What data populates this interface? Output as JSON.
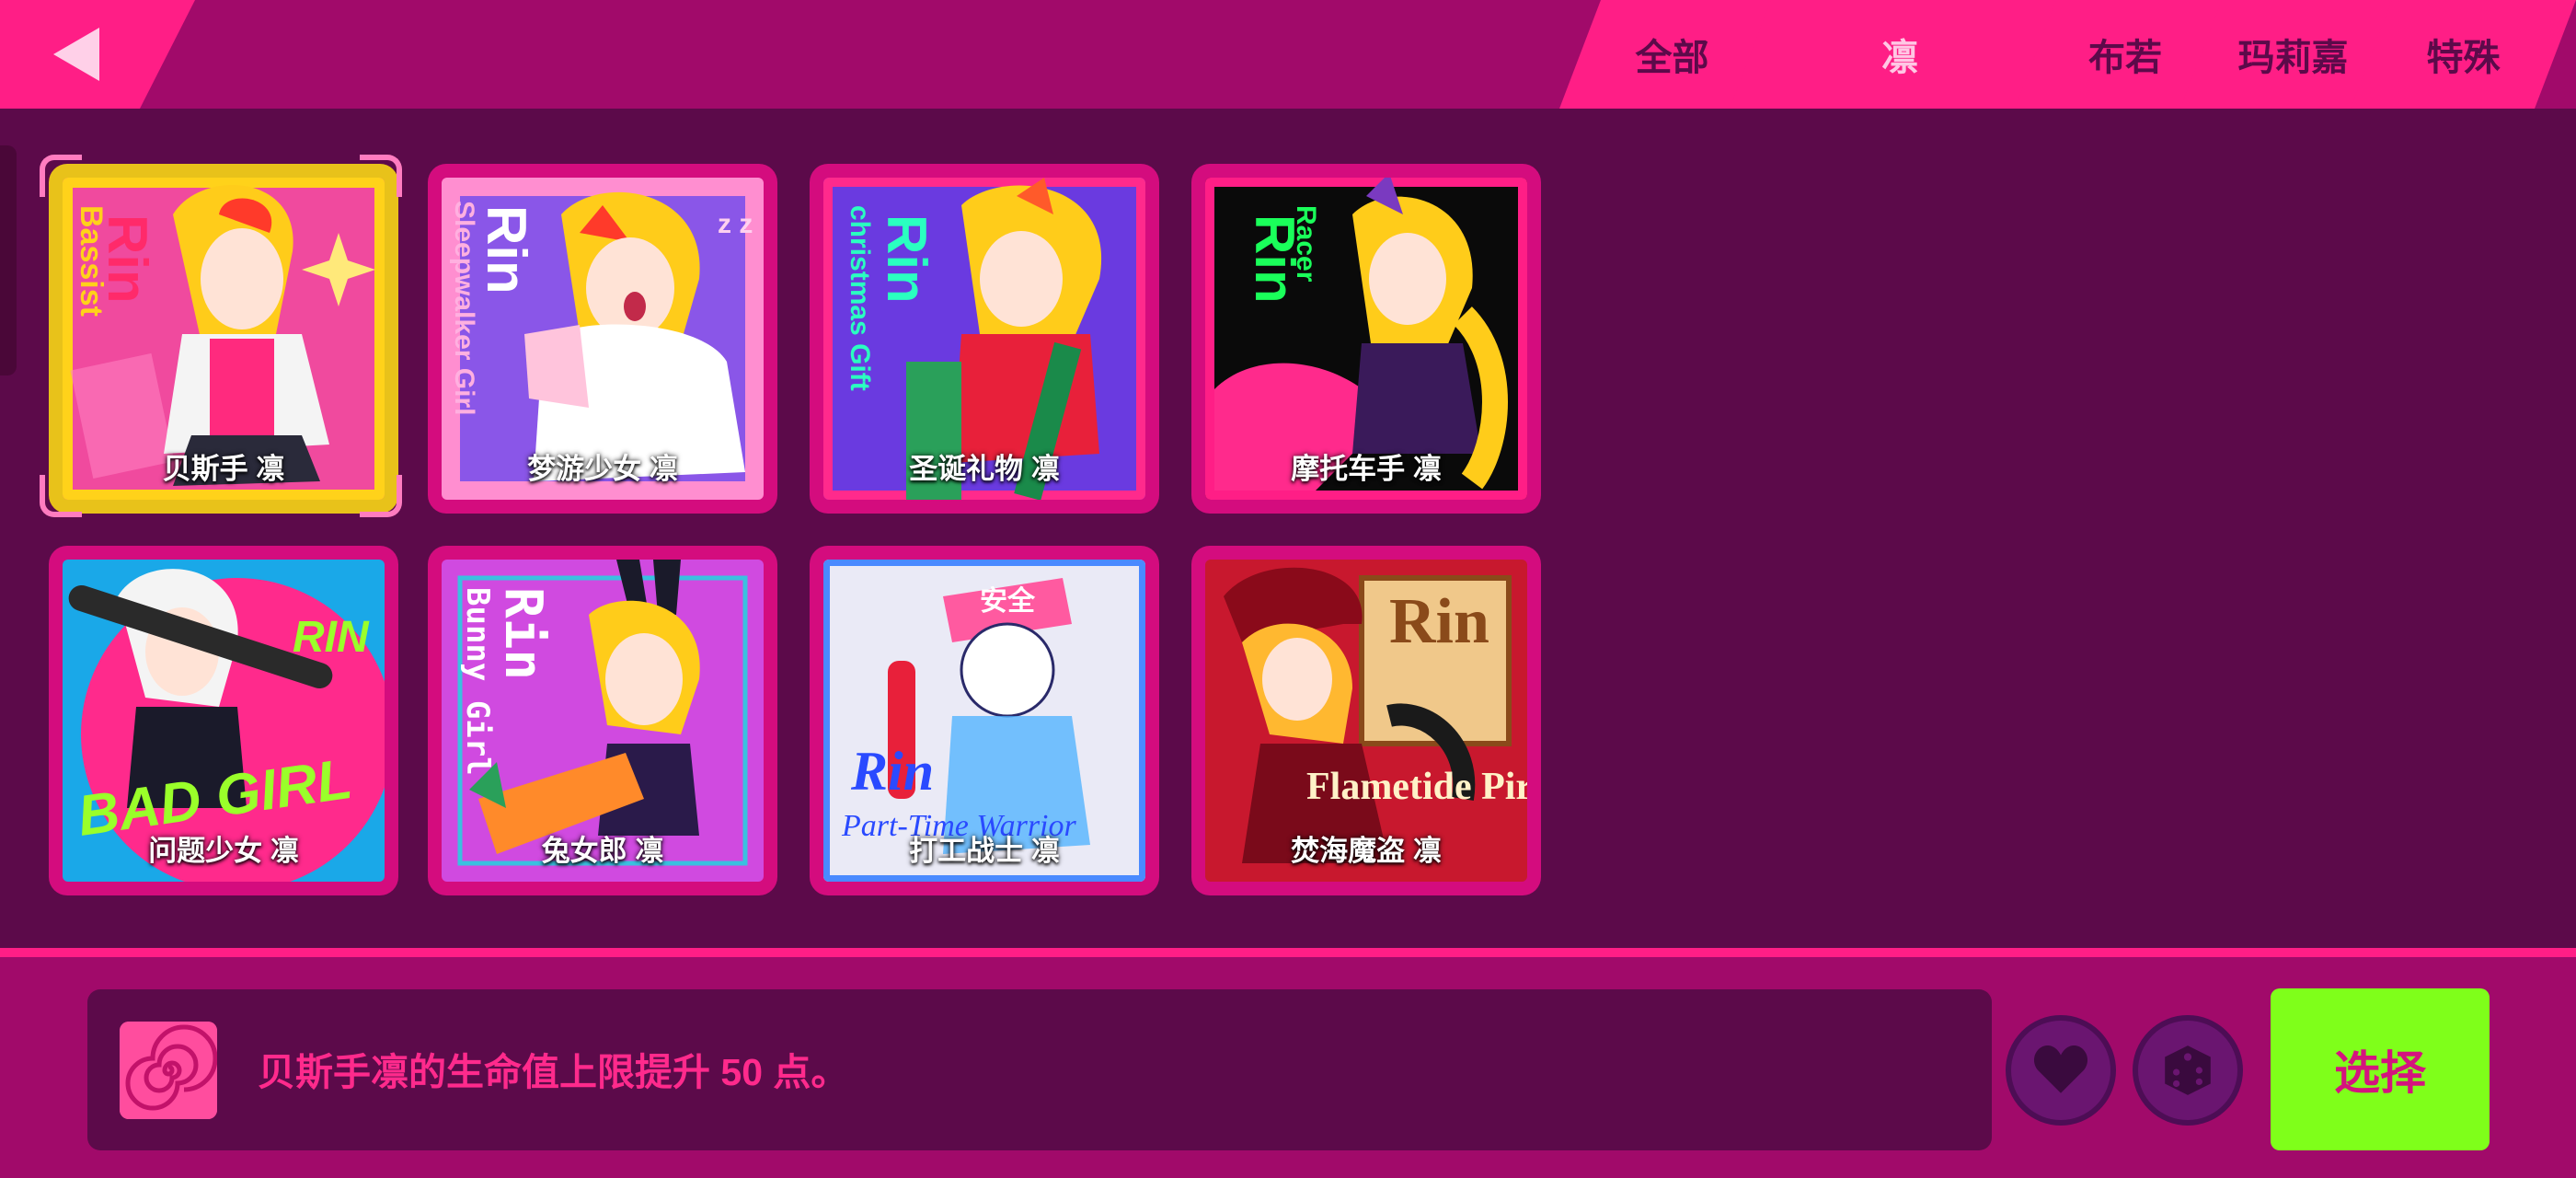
{
  "back_button": {
    "icon": "back-arrow-icon"
  },
  "tabs": [
    {
      "label": "全部",
      "active": false
    },
    {
      "label": "凛",
      "active": true
    },
    {
      "label": "布若",
      "active": false
    },
    {
      "label": "玛莉嘉",
      "active": false
    },
    {
      "label": "特殊",
      "active": false
    }
  ],
  "skins": [
    {
      "name": "贝斯手 凛",
      "art_text": "Rin",
      "art_subtitle": "Bassist",
      "selected": true
    },
    {
      "name": "梦游少女 凛",
      "art_text": "Rin",
      "art_subtitle": "Sleepwalker Girl",
      "selected": false
    },
    {
      "name": "圣诞礼物 凛",
      "art_text": "Rin",
      "art_subtitle": "christmas Gift",
      "selected": false
    },
    {
      "name": "摩托车手 凛",
      "art_text": "Rin",
      "art_subtitle": "Racer",
      "selected": false
    },
    {
      "name": "问题少女 凛",
      "art_text": "RIN",
      "art_subtitle": "BAD GIRL",
      "selected": false
    },
    {
      "name": "兔女郎 凛",
      "art_text": "Rin",
      "art_subtitle": "Bunny Girl",
      "selected": false
    },
    {
      "name": "打工战士 凛",
      "art_text": "Rin",
      "art_subtitle": "Part-Time Warrior",
      "art_extra": "安全",
      "selected": false
    },
    {
      "name": "焚海魔盗 凛",
      "art_text": "Rin",
      "art_subtitle": "Flametide Pirate",
      "selected": false
    }
  ],
  "description": {
    "icon": "spiral-icon",
    "text": "贝斯手凛的生命值上限提升 50 点。"
  },
  "actions": {
    "favorite_icon": "heart-icon",
    "random_icon": "dice-icon",
    "select_label": "选择"
  },
  "colors": {
    "background": "#5c0a4a",
    "bar": "#a10a6a",
    "accent_pink": "#ff1e86",
    "select_green": "#7fff1a"
  }
}
